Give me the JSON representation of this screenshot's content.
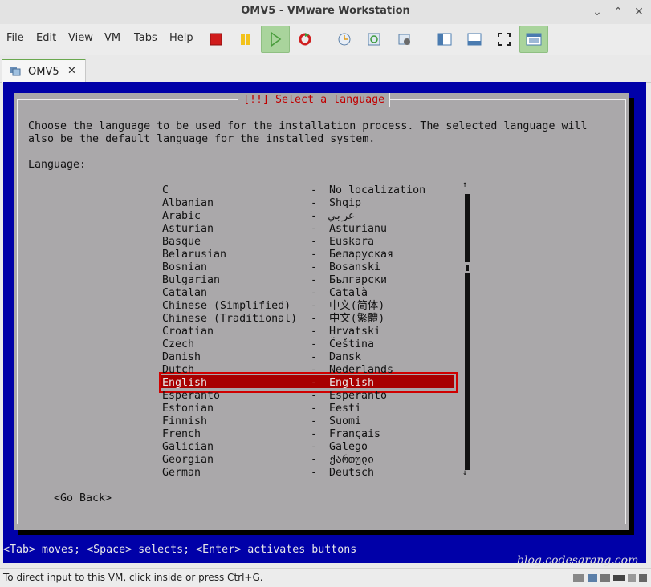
{
  "window": {
    "title": "OMV5 - VMware Workstation"
  },
  "menu": [
    "File",
    "Edit",
    "View",
    "VM",
    "Tabs",
    "Help"
  ],
  "toolbar_icons": [
    "power-off-icon",
    "pause-icon",
    "play-icon",
    "reset-icon",
    "snapshot-icon",
    "revert-snapshot-icon",
    "snapshot-manager-icon",
    "sidebar-toggle-icon",
    "thumbnail-bar-icon",
    "fullscreen-icon",
    "unity-console-icon"
  ],
  "tab": {
    "label": "OMV5",
    "close": "✕"
  },
  "dialog": {
    "title": "[!!] Select a language",
    "intro_line1": "Choose the language to be used for the installation process. The selected language will",
    "intro_line2": "also be the default language for the installed system.",
    "language_label": "Language:",
    "languages": [
      {
        "name": "C",
        "native": "No localization"
      },
      {
        "name": "Albanian",
        "native": "Shqip"
      },
      {
        "name": "Arabic",
        "native": "عربي"
      },
      {
        "name": "Asturian",
        "native": "Asturianu"
      },
      {
        "name": "Basque",
        "native": "Euskara"
      },
      {
        "name": "Belarusian",
        "native": "Беларуская"
      },
      {
        "name": "Bosnian",
        "native": "Bosanski"
      },
      {
        "name": "Bulgarian",
        "native": "Български"
      },
      {
        "name": "Catalan",
        "native": "Català"
      },
      {
        "name": "Chinese (Simplified)",
        "native": "中文(简体)"
      },
      {
        "name": "Chinese (Traditional)",
        "native": "中文(繁體)"
      },
      {
        "name": "Croatian",
        "native": "Hrvatski"
      },
      {
        "name": "Czech",
        "native": "Čeština"
      },
      {
        "name": "Danish",
        "native": "Dansk"
      },
      {
        "name": "Dutch",
        "native": "Nederlands"
      },
      {
        "name": "English",
        "native": "English"
      },
      {
        "name": "Esperanto",
        "native": "Esperanto"
      },
      {
        "name": "Estonian",
        "native": "Eesti"
      },
      {
        "name": "Finnish",
        "native": "Suomi"
      },
      {
        "name": "French",
        "native": "Français"
      },
      {
        "name": "Galician",
        "native": "Galego"
      },
      {
        "name": "Georgian",
        "native": "ქართული"
      },
      {
        "name": "German",
        "native": "Deutsch"
      }
    ],
    "separator": "-",
    "selected": "English",
    "go_back": "<Go Back>"
  },
  "hint_line": "<Tab> moves; <Space> selects; <Enter> activates buttons",
  "watermark": "blog.codesarang.com",
  "status": {
    "message": "To direct input to this VM, click inside or press Ctrl+G."
  },
  "colors": {
    "vm_background": "#0000a8",
    "dialog": "#aaa8aa",
    "selection": "#a80000",
    "title_text": "#c00000",
    "active_tab": "#6aa84f"
  }
}
